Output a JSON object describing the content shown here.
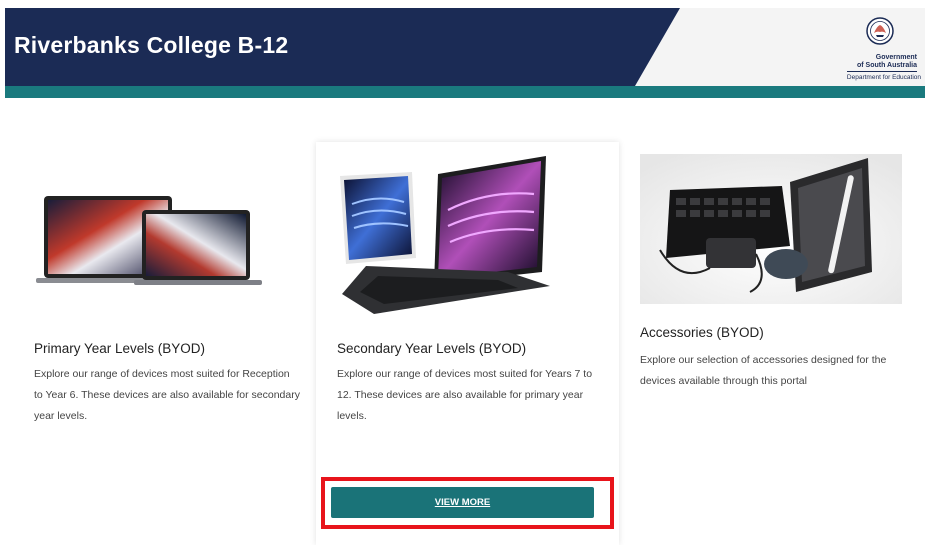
{
  "header": {
    "site_title": "Riverbanks College B-12",
    "gov_logo": {
      "line1": "Government",
      "line2": "of South Australia",
      "line3": "Department for Education"
    }
  },
  "cards": [
    {
      "title": "Primary Year Levels (BYOD)",
      "description": "Explore our range of devices most suited for Reception to Year 6. These devices are also available for secondary year levels."
    },
    {
      "title": "Secondary Year Levels (BYOD)",
      "description": "Explore our range of devices most suited for Years 7 to 12. These devices are also available for primary year levels.",
      "button_label": "VIEW MORE"
    },
    {
      "title": "Accessories (BYOD)",
      "description": "Explore our selection of accessories designed for the devices available through this portal"
    }
  ],
  "colors": {
    "header_navy": "#1b2b55",
    "header_teal": "#1a7a7e",
    "button_teal": "#1a7378",
    "highlight_red": "#e8141b"
  }
}
